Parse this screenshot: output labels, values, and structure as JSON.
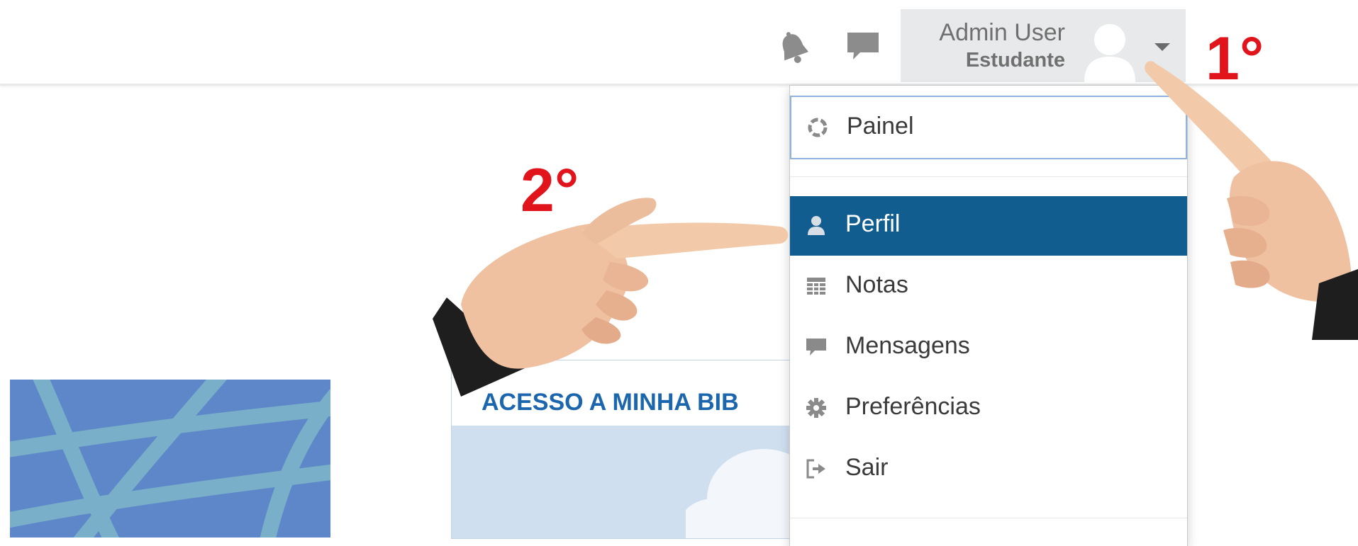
{
  "header": {
    "user_name": "Admin User",
    "user_role": "Estudante",
    "icons": [
      "bell-icon",
      "message-icon",
      "avatar-icon",
      "caret-down-icon"
    ]
  },
  "user_menu": {
    "items": [
      {
        "label": "Painel",
        "icon": "dashboard-icon"
      },
      {
        "label": "Perfil",
        "icon": "user-icon",
        "active": true
      },
      {
        "label": "Notas",
        "icon": "grades-table-icon"
      },
      {
        "label": "Mensagens",
        "icon": "message-icon"
      },
      {
        "label": "Preferências",
        "icon": "gear-icon"
      },
      {
        "label": "Sair",
        "icon": "logout-icon"
      }
    ]
  },
  "content": {
    "library_card_title": "ACESSO A MINHA BIB"
  },
  "annotations": {
    "step1": "1°",
    "step2": "2°"
  },
  "colors": {
    "active_item_bg": "#125d8f",
    "step_label": "#e1141c",
    "library_title": "#1b66ad"
  }
}
